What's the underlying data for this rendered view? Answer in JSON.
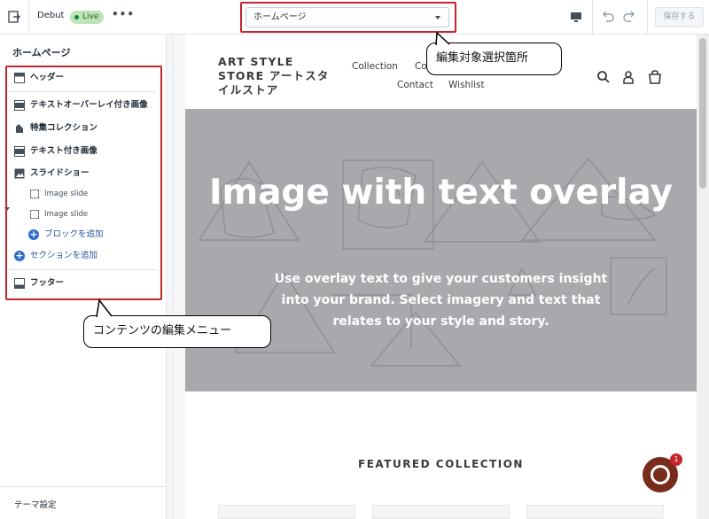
{
  "topbar": {
    "theme_name": "Debut",
    "live_badge": "Live",
    "more_label": "•••",
    "page_select_value": "ホームページ",
    "save_label": "保存する"
  },
  "sidebar": {
    "title": "ホームページ",
    "items": [
      {
        "label": "ヘッダー",
        "icon": "header-section-icon"
      },
      {
        "label": "テキストオーバーレイ付き画像",
        "icon": "image-overlay-icon"
      },
      {
        "label": "特集コレクション",
        "icon": "collection-tag-icon"
      },
      {
        "label": "テキスト付き画像",
        "icon": "image-text-icon"
      },
      {
        "label": "スライドショー",
        "icon": "slideshow-icon"
      }
    ],
    "slides": [
      {
        "label": "Image slide"
      },
      {
        "label": "Image slide"
      }
    ],
    "add_block": "ブロックを追加",
    "add_section": "セクションを追加",
    "footer_item": "フッター",
    "theme_settings": "テーマ設定"
  },
  "callouts": {
    "selector": "編集対象選択箇所",
    "menu": "コンテンツの編集メニュー"
  },
  "preview": {
    "store_logo": "ART STYLE STORE アートスタイルストア",
    "nav": [
      "Collection",
      "Co",
      "Contact",
      "Wishlist"
    ],
    "hero_title": "Image with text overlay",
    "hero_text": "Use overlay text to give your customers insight into your brand. Select imagery and text that relates to your style and story.",
    "featured_title": "FEATURED COLLECTION",
    "chat_badge": "1"
  },
  "colors": {
    "highlight": "#c5252c",
    "hero_bg": "#a9a9ad",
    "live_green": "#bbe5b3",
    "add_link": "#1f5199"
  }
}
